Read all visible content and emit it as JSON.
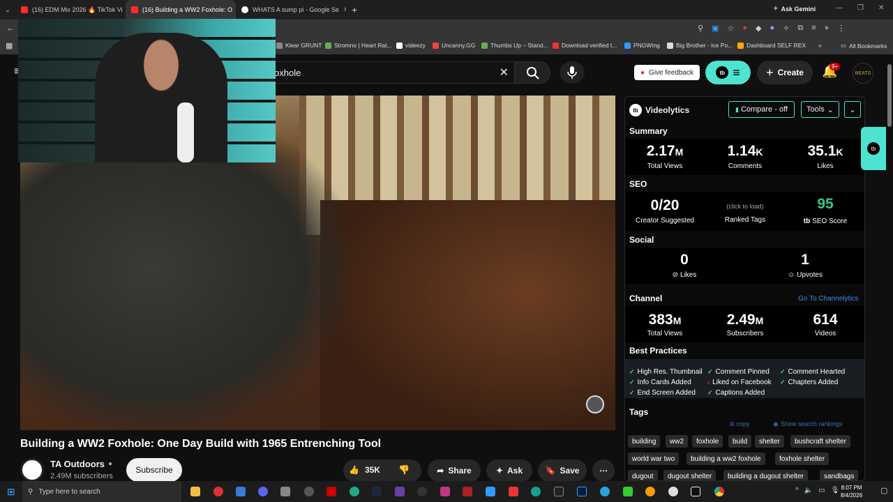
{
  "tabs": [
    {
      "title": "(16) EDM Mix 2026 🔥 TikTok Vi",
      "favicon": "youtube-icon",
      "active": false
    },
    {
      "title": "(16) Building a WW2 Foxhole: O",
      "favicon": "youtube-icon",
      "active": true
    },
    {
      "title": "WHATS A sump pi - Google Se",
      "favicon": "google-icon",
      "active": false
    }
  ],
  "ask_gemini": "Ask Gemini",
  "bookmarks": [
    "Klear GRUNT",
    "Stromno | Heart Rat...",
    "videezy",
    "Uncanny.GG",
    "Thumbs Up – Stand...",
    "Download verified t...",
    "PNGWing",
    "Big Brother - Ice Po...",
    "Dashboard SELF REX"
  ],
  "all_bookmarks": "All Bookmarks",
  "search": {
    "value": "oxhole"
  },
  "header": {
    "feedback": "Give feedback",
    "create": "Create",
    "notif_badge": "9+",
    "avatar_text": "BEATS"
  },
  "video": {
    "title": "Building a WW2 Foxhole: One Day Build with 1965 Entrenching Tool"
  },
  "channel": {
    "name": "TA Outdoors",
    "subs": "2.49M subscribers",
    "subscribe": "Subscribe"
  },
  "actions": {
    "likes": "35K",
    "share": "Share",
    "ask": "Ask",
    "save": "Save"
  },
  "panel": {
    "brand": "Videolytics",
    "compare": "Compare - off",
    "tools": "Tools",
    "summary_title": "Summary",
    "summary": [
      {
        "v": "2.17",
        "u": "M",
        "l": "Total Views"
      },
      {
        "v": "1.14",
        "u": "K",
        "l": "Comments"
      },
      {
        "v": "35.1",
        "u": "K",
        "l": "Likes"
      }
    ],
    "seo_title": "SEO",
    "seo": {
      "creator": "0/20",
      "creator_l": "Creator Suggested",
      "ranked_hint": "(click to load)",
      "ranked_l": "Ranked Tags",
      "score": "95",
      "score_l": "SEO Score"
    },
    "social_title": "Social",
    "social": {
      "likes": "0",
      "likes_l": "Likes",
      "upvotes": "1",
      "upvotes_l": "Upvotes"
    },
    "channel_title": "Channel",
    "channel_link": "Go To Channelytics",
    "channel": [
      {
        "v": "383",
        "u": "M",
        "l": "Total Views"
      },
      {
        "v": "2.49",
        "u": "M",
        "l": "Subscribers"
      },
      {
        "v": "614",
        "u": "",
        "l": "Videos"
      }
    ],
    "bp_title": "Best Practices",
    "bp": [
      {
        "t": "High Res. Thumbnail",
        "ok": true
      },
      {
        "t": "Comment Pinned",
        "ok": true
      },
      {
        "t": "Comment Hearted",
        "ok": true
      },
      {
        "t": "Info Cards Added",
        "ok": true
      },
      {
        "t": "Liked on Facebook",
        "ok": false
      },
      {
        "t": "Chapters Added",
        "ok": true
      },
      {
        "t": "End Screen Added",
        "ok": true
      },
      {
        "t": "Captions Added",
        "ok": true
      }
    ],
    "tags_title": "Tags",
    "copy": "copy",
    "show_rankings": "Show search rankings",
    "tags": [
      "building",
      "ww2",
      "foxhole",
      "build",
      "shelter",
      "bushcraft shelter",
      "world war two",
      "building a ww2 foxhole",
      "foxhole shelter",
      "dugout",
      "dugout shelter",
      "building a dugout shelter",
      "sandbags"
    ]
  },
  "taskbar": {
    "search": "Type here to search",
    "time": "8:07 PM",
    "date": "8/4/2026"
  }
}
